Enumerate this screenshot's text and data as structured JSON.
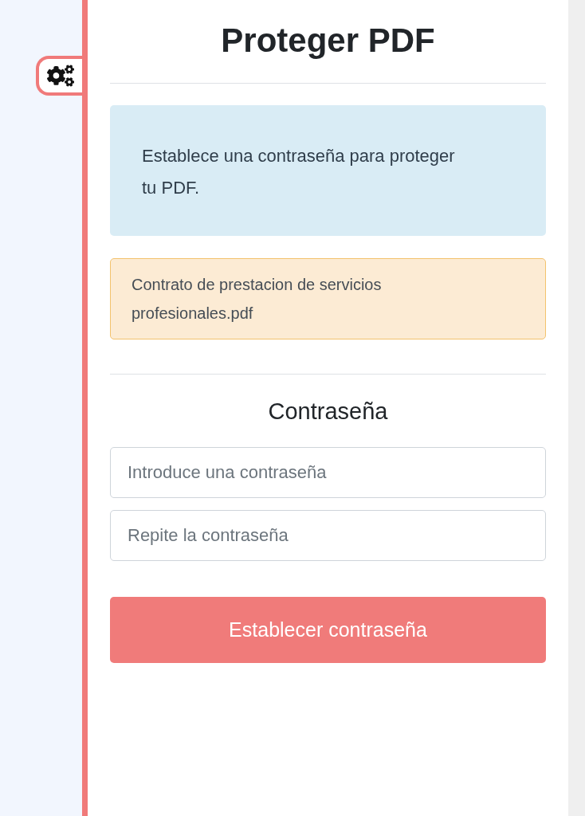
{
  "title": "Proteger PDF",
  "info": "Establece una contraseña para proteger tu PDF.",
  "file_name": "Contrato de prestacion de servicios profesionales.pdf",
  "section_title": "Contraseña",
  "fields": [
    {
      "placeholder": "Introduce una contraseña"
    },
    {
      "placeholder": "Repite la contraseña"
    }
  ],
  "submit_button": "Establecer contraseña"
}
